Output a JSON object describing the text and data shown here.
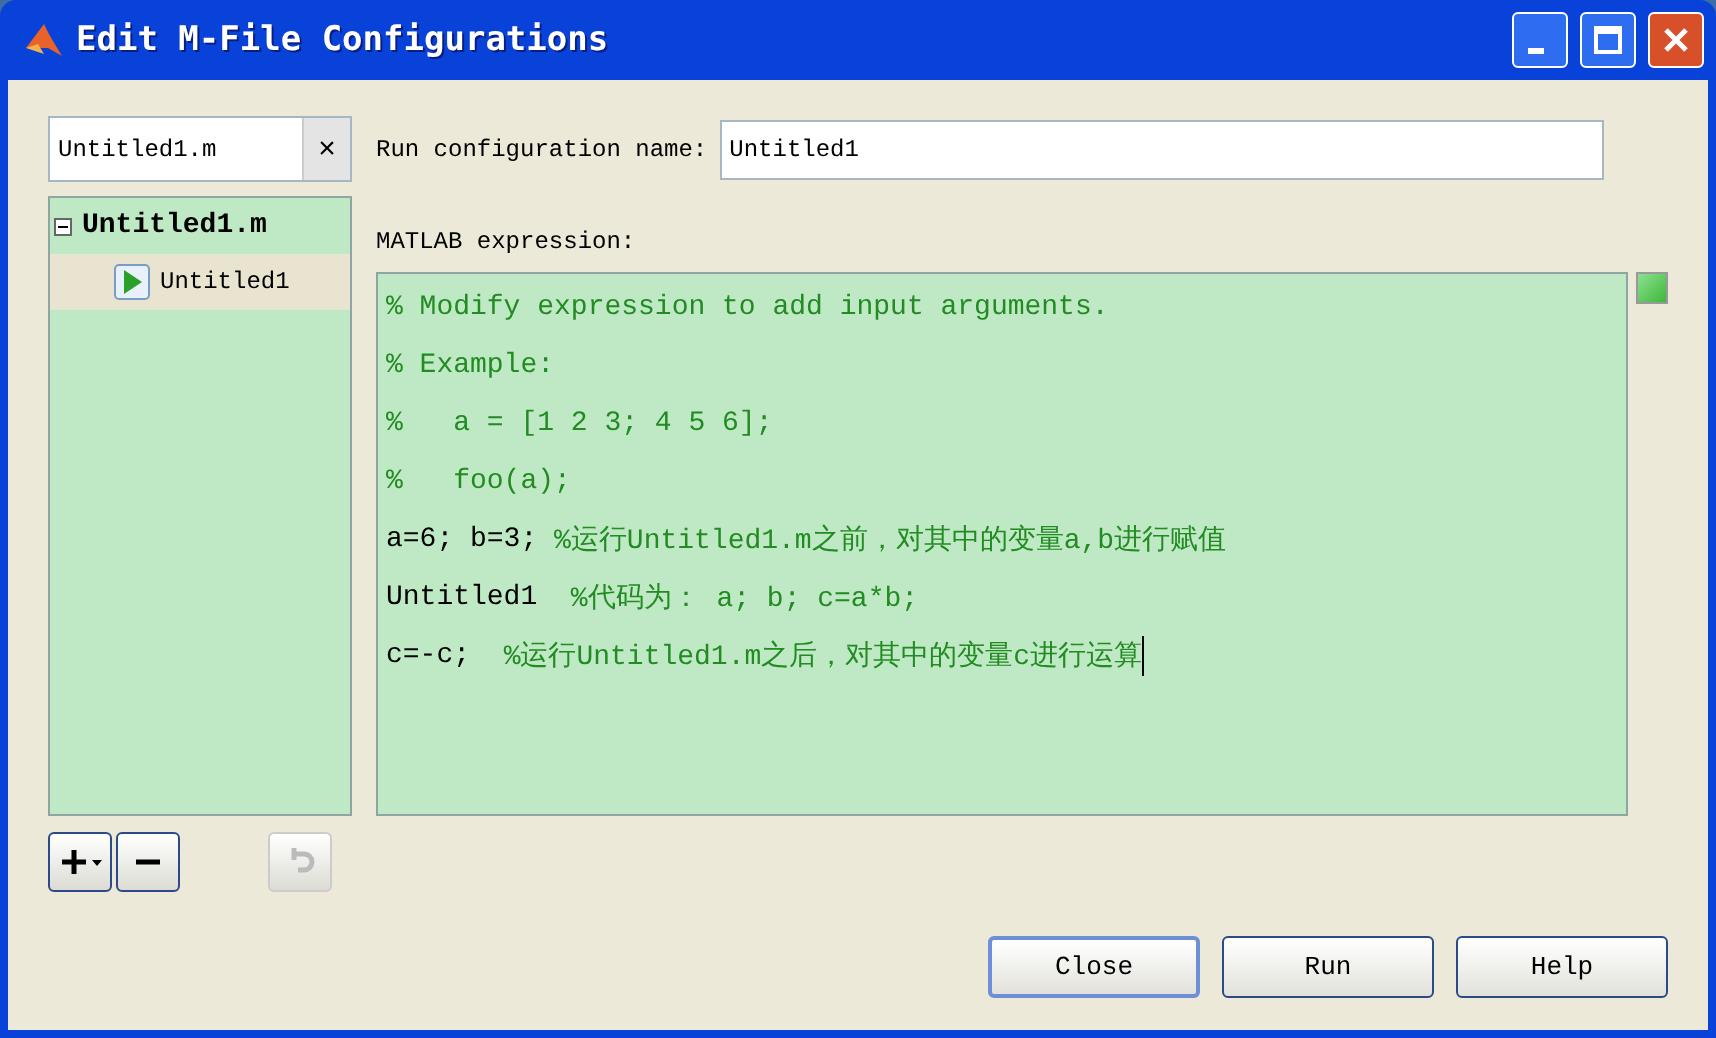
{
  "window": {
    "title": "Edit M-File Configurations"
  },
  "filter": {
    "value": "Untitled1.m",
    "clear": "×"
  },
  "tree": [
    {
      "label": "Untitled1.m",
      "expanded": true,
      "children": [
        {
          "label": "Untitled1",
          "selected": true
        }
      ]
    }
  ],
  "config_name": {
    "label": "Run configuration name:",
    "value": "Untitled1"
  },
  "expression": {
    "label": "MATLAB expression:",
    "lines": [
      {
        "comment": "% Modify expression to add input arguments."
      },
      {
        "comment": "% Example:"
      },
      {
        "comment": "%   a = [1 2 3; 4 5 6];"
      },
      {
        "comment": "%   foo(a);"
      },
      {
        "code": "a=6; b=3; ",
        "comment": "%运行Untitled1.m之前，对其中的变量a,b进行赋值"
      },
      {
        "code": "Untitled1  ",
        "comment": "%代码为： a; b; c=a*b;"
      },
      {
        "code": "c=-c;  ",
        "comment": "%运行Untitled1.m之后，对其中的变量c进行运算",
        "caret": true
      }
    ]
  },
  "tool_buttons": [
    {
      "kind": "add",
      "disabled": false
    },
    {
      "kind": "remove",
      "disabled": false
    },
    {
      "kind": "undo",
      "disabled": true
    }
  ],
  "buttons": [
    {
      "label": "Close",
      "default": true
    },
    {
      "label": "Run",
      "default": false
    },
    {
      "label": "Help",
      "default": false
    }
  ]
}
